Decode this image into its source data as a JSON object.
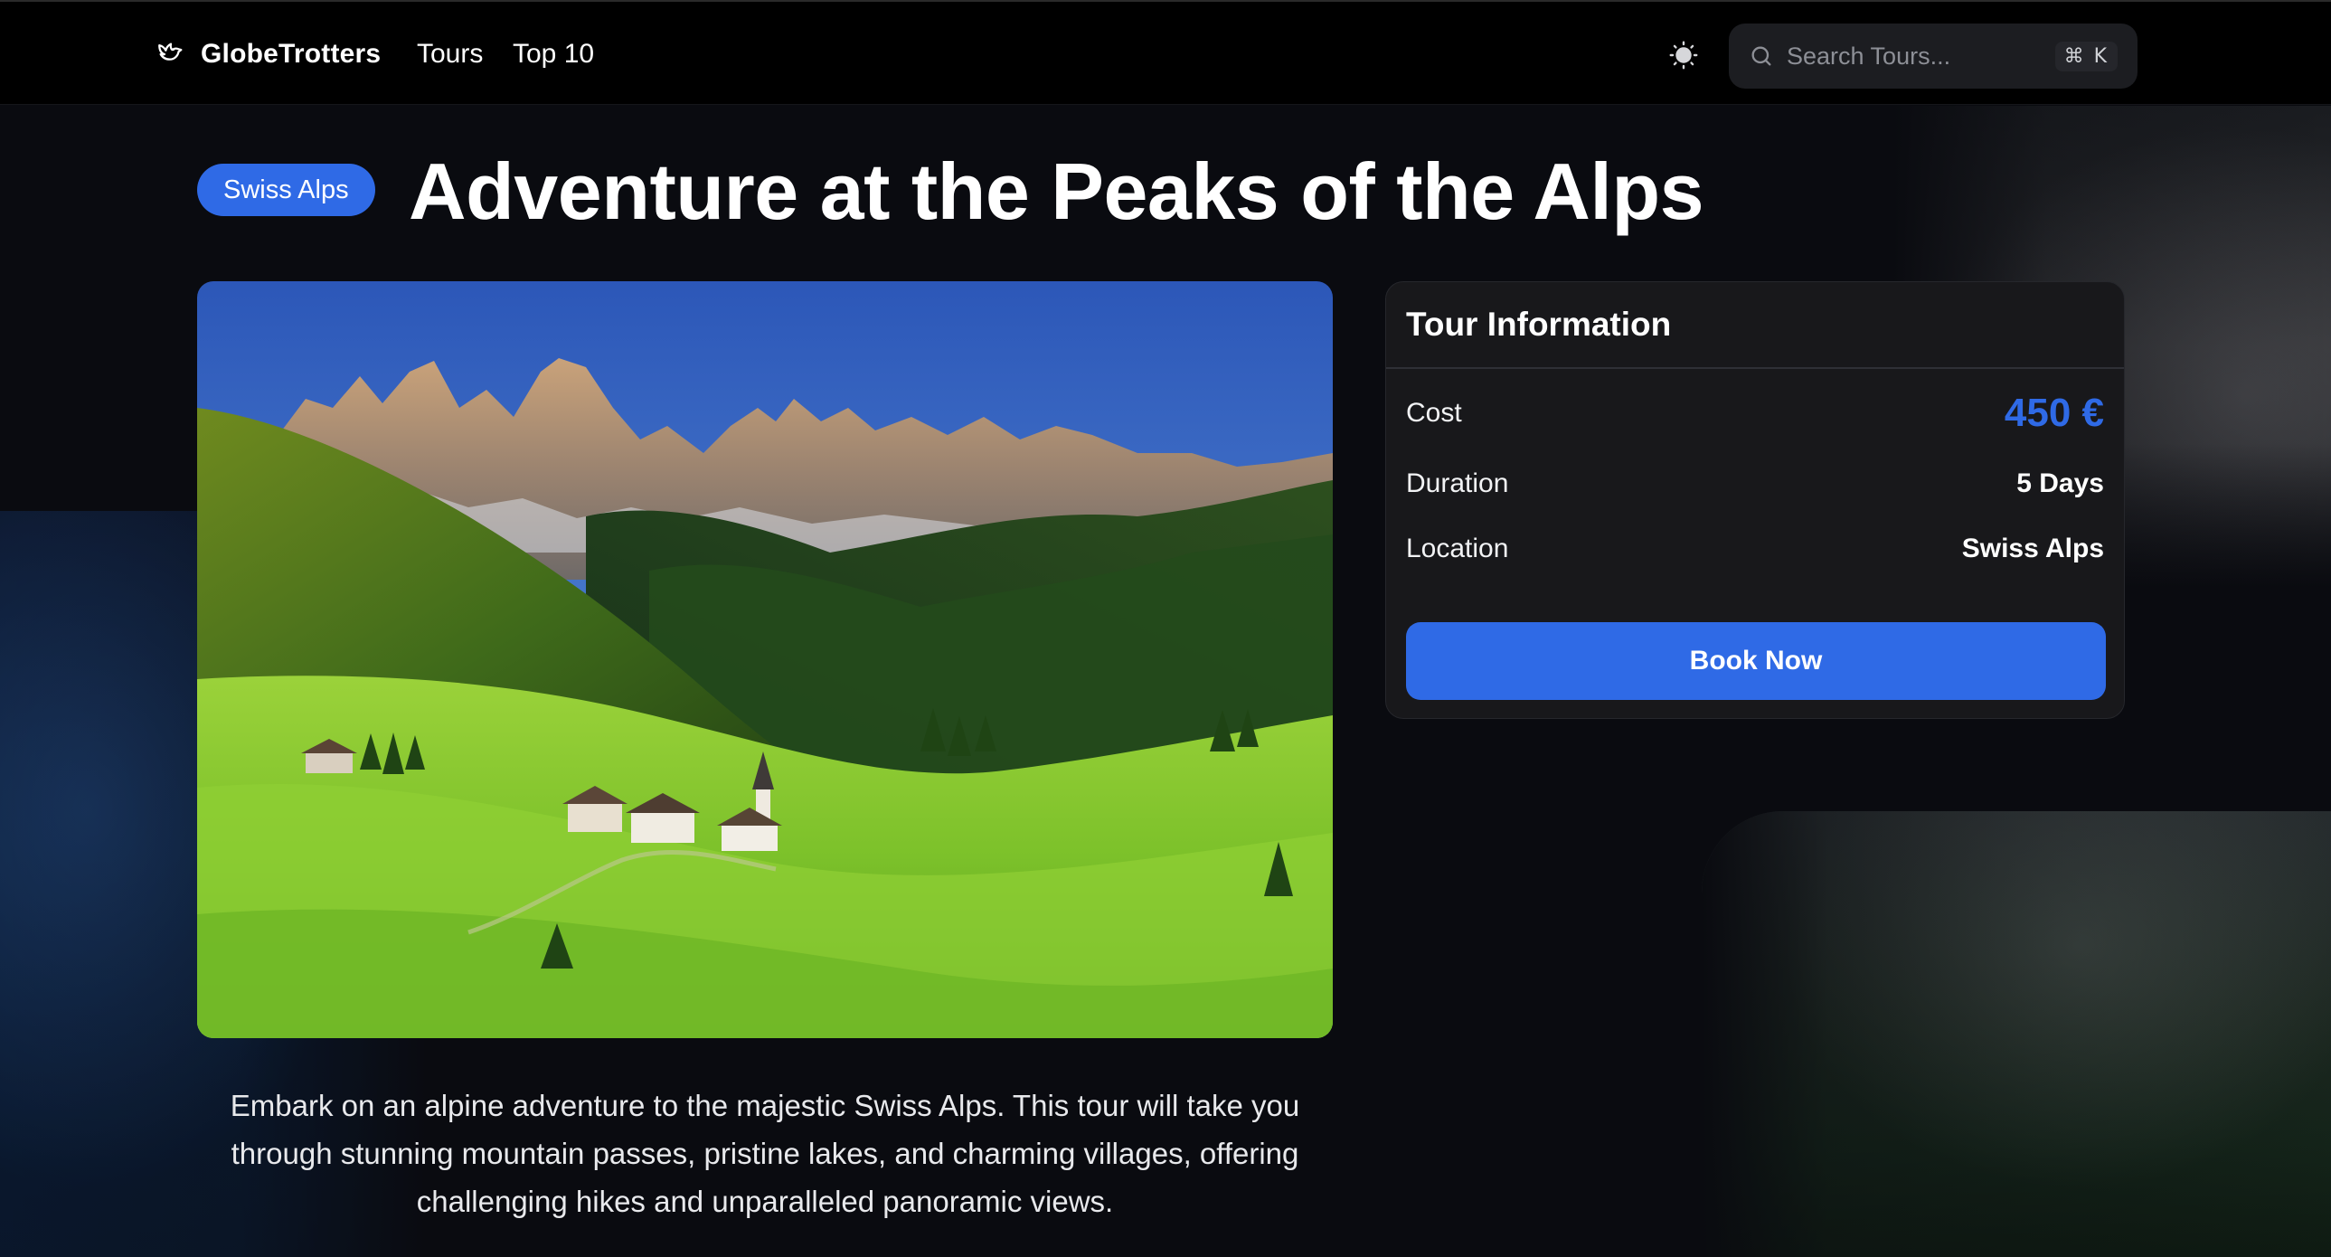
{
  "nav": {
    "brand": "GlobeTrotters",
    "brand_icon": "dove-icon",
    "links": [
      "Tours",
      "Top 10"
    ],
    "theme_icon": "sun-icon",
    "search": {
      "placeholder": "Search Tours...",
      "shortcut": "⌘ K",
      "icon": "search-icon"
    }
  },
  "tour": {
    "badge": "Swiss Alps",
    "title": "Adventure at the Peaks of the Alps",
    "description": "Embark on an alpine adventure to the majestic Swiss Alps. This tour will take you through stunning mountain passes, pristine lakes, and charming villages, offering challenging hikes and unparalleled panoramic views."
  },
  "info_card": {
    "title": "Tour Information",
    "rows": [
      {
        "label": "Cost",
        "value": "450 €"
      },
      {
        "label": "Duration",
        "value": "5 Days"
      },
      {
        "label": "Location",
        "value": "Swiss Alps"
      }
    ],
    "button": "Book Now"
  },
  "colors": {
    "accent": "#2f6ae6",
    "background": "#0a0b10",
    "nav_background": "#000000",
    "card_background": "#18181b"
  }
}
